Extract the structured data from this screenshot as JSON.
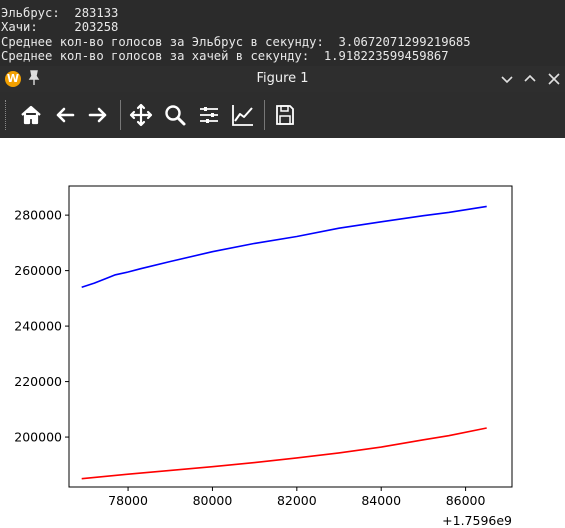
{
  "terminal": {
    "partial_line": "                                          ",
    "lines": [
      "Эльбрус:  283133",
      "Хачи:     203258",
      "Среднее кол-во голосов за Эльбрус в секунду:  3.0672071299219685",
      "Среднее кол-во голосов за хачей в секунду:  1.918223599459867"
    ]
  },
  "window": {
    "title": "Figure 1",
    "app_icon": "W"
  },
  "toolbar": {
    "buttons": [
      "home-icon",
      "back-icon",
      "forward-icon",
      "pan-icon",
      "zoom-icon",
      "subplots-icon",
      "edit-axes-icon",
      "save-icon"
    ]
  },
  "chart_data": {
    "type": "line",
    "x_offset_label": "+1.7596e9",
    "xlim": [
      76600,
      87100
    ],
    "ylim": [
      182000,
      290500
    ],
    "x_ticks": [
      "78000",
      "80000",
      "82000",
      "84000",
      "86000"
    ],
    "x_tick_values": [
      78000,
      80000,
      82000,
      84000,
      86000
    ],
    "y_ticks": [
      "200000",
      "220000",
      "240000",
      "260000",
      "280000"
    ],
    "y_tick_values": [
      200000,
      220000,
      240000,
      260000,
      280000
    ],
    "series": [
      {
        "color": "#0000ff",
        "x": [
          76900,
          77200,
          77500,
          77700,
          78000,
          78300,
          79000,
          80000,
          81000,
          82000,
          83000,
          84000,
          85000,
          85600,
          86500
        ],
        "y": [
          254000,
          255500,
          257300,
          258500,
          259500,
          260700,
          263300,
          266800,
          269800,
          272300,
          275300,
          277600,
          279800,
          281000,
          283133
        ]
      },
      {
        "color": "#ff0000",
        "x": [
          76900,
          78000,
          79000,
          80000,
          81000,
          82000,
          83000,
          84000,
          85000,
          85600,
          86500
        ],
        "y": [
          185000,
          186600,
          188000,
          189300,
          190800,
          192500,
          194300,
          196400,
          199000,
          200500,
          203258
        ]
      }
    ]
  }
}
